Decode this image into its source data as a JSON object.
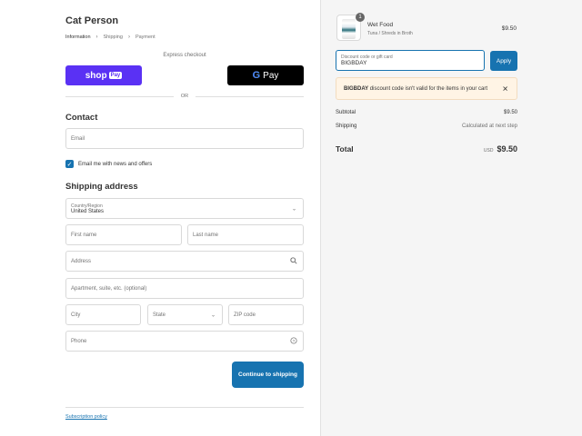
{
  "store": {
    "name": "Cat Person"
  },
  "breadcrumb": {
    "information": "Information",
    "shipping": "Shipping",
    "payment": "Payment",
    "separator": "›"
  },
  "express": {
    "label": "Express checkout",
    "shop_pay_shop": "shop",
    "shop_pay_pay": "Pay",
    "gpay_g": "G",
    "gpay_pay": "Pay",
    "or": "OR"
  },
  "contact": {
    "title": "Contact",
    "email_placeholder": "Email",
    "news_label": "Email me with news and offers",
    "news_checked": true
  },
  "shipping": {
    "title": "Shipping address",
    "country_label": "Country/Region",
    "country_value": "United States",
    "first_name": "First name",
    "last_name": "Last name",
    "address": "Address",
    "apartment": "Apartment, suite, etc. (optional)",
    "city": "City",
    "state": "State",
    "zip": "ZIP code",
    "phone": "Phone"
  },
  "actions": {
    "continue": "Continue to shipping"
  },
  "footer": {
    "policy": "Subscription policy"
  },
  "cart": {
    "item": {
      "quantity": "1",
      "name": "Wet Food",
      "variant": "Tuna / Shreds in Broth",
      "price": "$9.50"
    },
    "discount": {
      "label": "Discount code or gift card",
      "value": "BIGBDAY",
      "apply": "Apply"
    },
    "alert": {
      "code": "BIGBDAY",
      "message": " discount code isn't valid for the items in your cart",
      "close": "✕"
    },
    "subtotal_label": "Subtotal",
    "subtotal_value": "$9.50",
    "shipping_label": "Shipping",
    "shipping_value": "Calculated at next step",
    "total_label": "Total",
    "total_currency": "USD",
    "total_value": "$9.50"
  },
  "colors": {
    "accent": "#1773b0",
    "shop_pay": "#5a31f4",
    "gpay": "#000000",
    "alert_bg": "#fff4e5"
  }
}
